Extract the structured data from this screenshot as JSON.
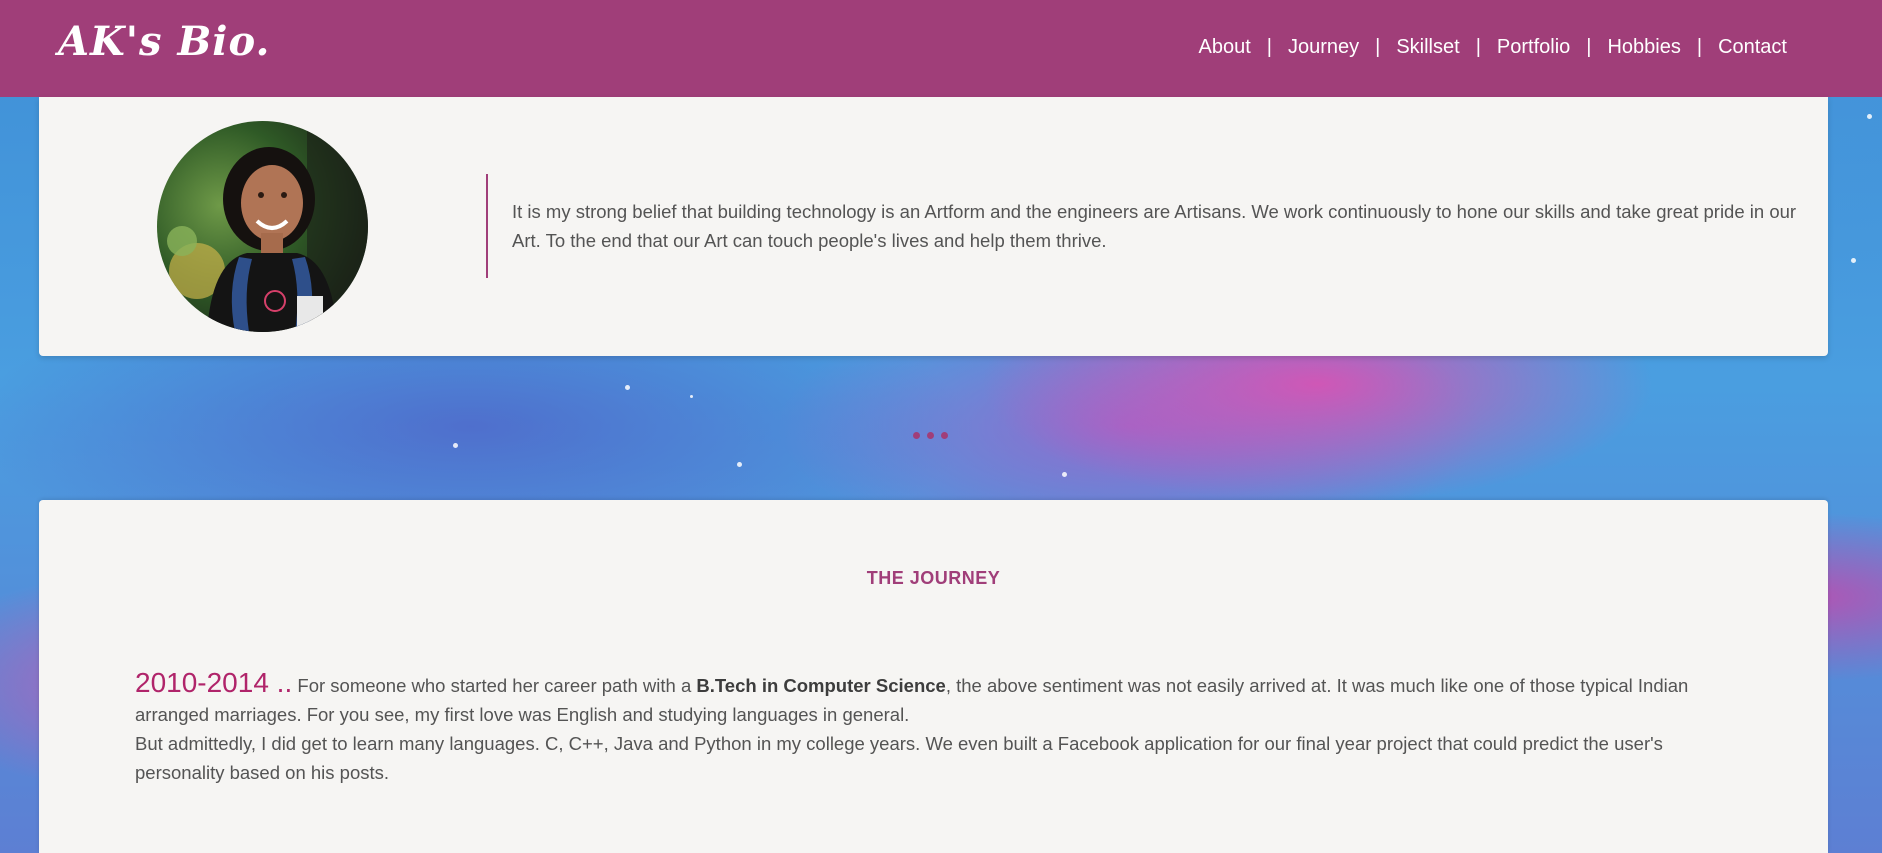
{
  "header": {
    "brand": "AK's Bio.",
    "nav": [
      "About",
      "Journey",
      "Skillset",
      "Portfolio",
      "Hobbies",
      "Contact"
    ],
    "separator": "|"
  },
  "intro": {
    "quote": "It is my strong belief that building technology is an Artform and the engineers are Artisans. We work continuously to hone our skills and take great pride in our Art. To the end that our Art can touch people's lives and help them thrive."
  },
  "journey": {
    "title": "THE JOURNEY",
    "period": "2010-2014 ..",
    "text_before_bold": " For someone who started her career path with a ",
    "bold": "B.Tech in Computer Science",
    "text_after_bold": ", the above sentiment was not easily arrived at. It was much like one of those typical Indian arranged marriages. For you see, my first love was English and studying languages in general.",
    "paragraph2": "But admittedly, I did get to learn many languages. C, C++, Java and Python in my college years. We even built a Facebook application for our final year project that could predict the user's personality based on his posts."
  },
  "colors": {
    "accent": "#a03e79",
    "year": "#b0246a",
    "card_bg": "#f6f5f3",
    "text": "#545454"
  }
}
